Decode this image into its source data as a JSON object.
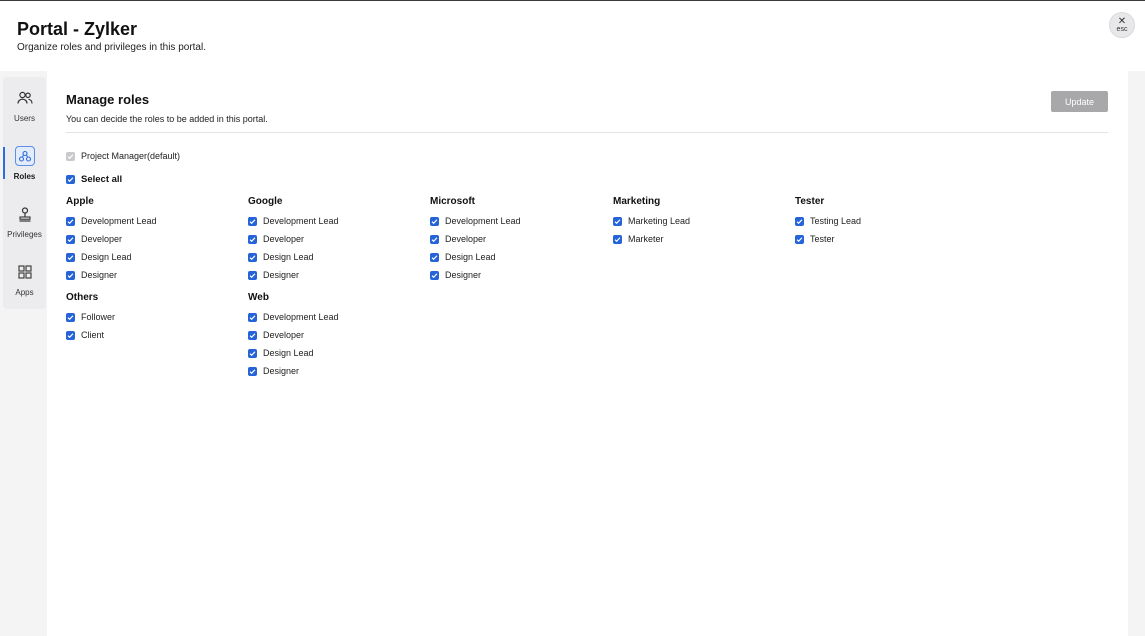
{
  "header": {
    "title": "Portal - Zylker",
    "subtitle": "Organize roles and privileges in this portal.",
    "close_icon": "x-icon",
    "close_label": "esc"
  },
  "sidebar": {
    "items": [
      {
        "label": "Users",
        "icon": "users-icon",
        "active": false
      },
      {
        "label": "Roles",
        "icon": "roles-icon",
        "active": true
      },
      {
        "label": "Privileges",
        "icon": "privileges-icon",
        "active": false
      },
      {
        "label": "Apps",
        "icon": "apps-grid-icon",
        "active": false
      }
    ]
  },
  "main": {
    "title": "Manage roles",
    "subtitle": "You can decide the roles to be added in this portal.",
    "update_label": "Update",
    "default_role": "Project Manager(default)",
    "select_all": "Select all",
    "groups": {
      "apple": {
        "title": "Apple",
        "roles": [
          "Development Lead",
          "Developer",
          "Design Lead",
          "Designer"
        ]
      },
      "google": {
        "title": "Google",
        "roles": [
          "Development Lead",
          "Developer",
          "Design Lead",
          "Designer"
        ]
      },
      "microsoft": {
        "title": "Microsoft",
        "roles": [
          "Development Lead",
          "Developer",
          "Design Lead",
          "Designer"
        ]
      },
      "marketing": {
        "title": "Marketing",
        "roles": [
          "Marketing Lead",
          "Marketer"
        ]
      },
      "tester": {
        "title": "Tester",
        "roles": [
          "Testing Lead",
          "Tester"
        ]
      },
      "others": {
        "title": "Others",
        "roles": [
          "Follower",
          "Client"
        ]
      },
      "web": {
        "title": "Web",
        "roles": [
          "Development Lead",
          "Developer",
          "Design Lead",
          "Designer"
        ]
      }
    }
  },
  "colors": {
    "accent": "#2563d8",
    "button_disabled": "#a8a8aa",
    "background": "#f4f4f5"
  }
}
